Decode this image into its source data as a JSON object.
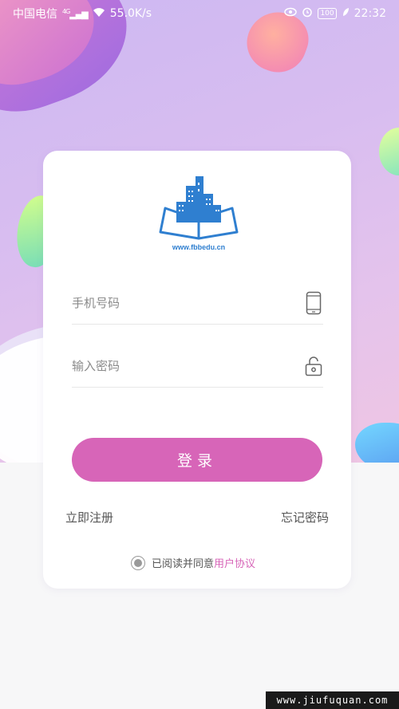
{
  "status_bar": {
    "carrier": "中国电信",
    "network": "4G",
    "speed": "55.0K/s",
    "battery": "100",
    "time": "22:32"
  },
  "logo": {
    "text": "www.fbbedu.cn"
  },
  "form": {
    "phone_placeholder": "手机号码",
    "password_placeholder": "输入密码",
    "login_label": "登录"
  },
  "links": {
    "register": "立即注册",
    "forgot": "忘记密码"
  },
  "agreement": {
    "text": "已阅读并同意",
    "link": "用户协议"
  },
  "watermark": "www.jiufuquan.com",
  "colors": {
    "accent": "#d765b8",
    "logo_blue": "#2f7fd0"
  }
}
